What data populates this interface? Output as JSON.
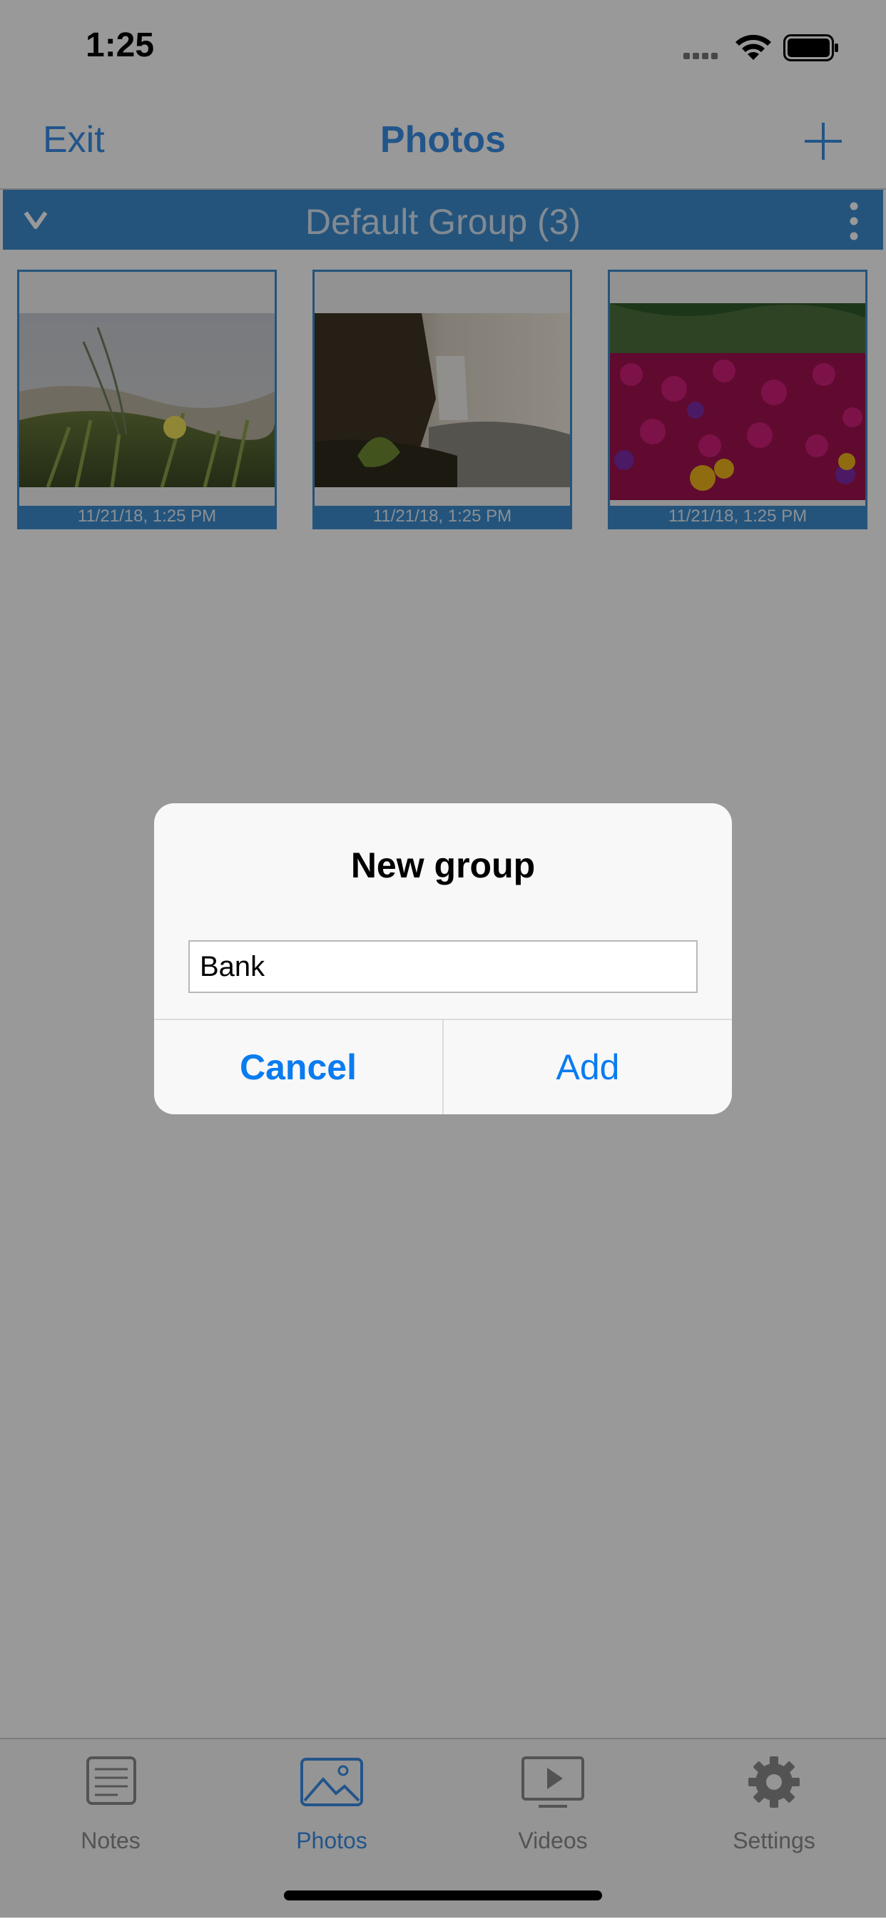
{
  "status_bar": {
    "time": "1:25"
  },
  "nav": {
    "exit_label": "Exit",
    "title": "Photos",
    "add_icon": "plus-icon"
  },
  "group": {
    "title": "Default Group (3)",
    "toggle_icon": "chevron-down-icon",
    "menu_icon": "more-vertical-icon"
  },
  "photos": [
    {
      "caption": "11/21/18, 1:25 PM",
      "subject": "dune grass with yellow flower"
    },
    {
      "caption": "11/21/18, 1:25 PM",
      "subject": "waterfall over rocks"
    },
    {
      "caption": "11/21/18, 1:25 PM",
      "subject": "magenta flower bed"
    }
  ],
  "dialog": {
    "title": "New group",
    "input_value": "Bank",
    "cancel_label": "Cancel",
    "add_label": "Add"
  },
  "tabs": [
    {
      "label": "Notes",
      "icon": "notes-icon",
      "active": false
    },
    {
      "label": "Photos",
      "icon": "photos-icon",
      "active": true
    },
    {
      "label": "Videos",
      "icon": "videos-icon",
      "active": false
    },
    {
      "label": "Settings",
      "icon": "gear-icon",
      "active": false
    }
  ],
  "colors": {
    "accent": "#3a8ee6",
    "group_header": "#3d8dcf",
    "dialog_button": "#0a7cf0",
    "overlay": "rgba(0,0,0,0.40)"
  }
}
